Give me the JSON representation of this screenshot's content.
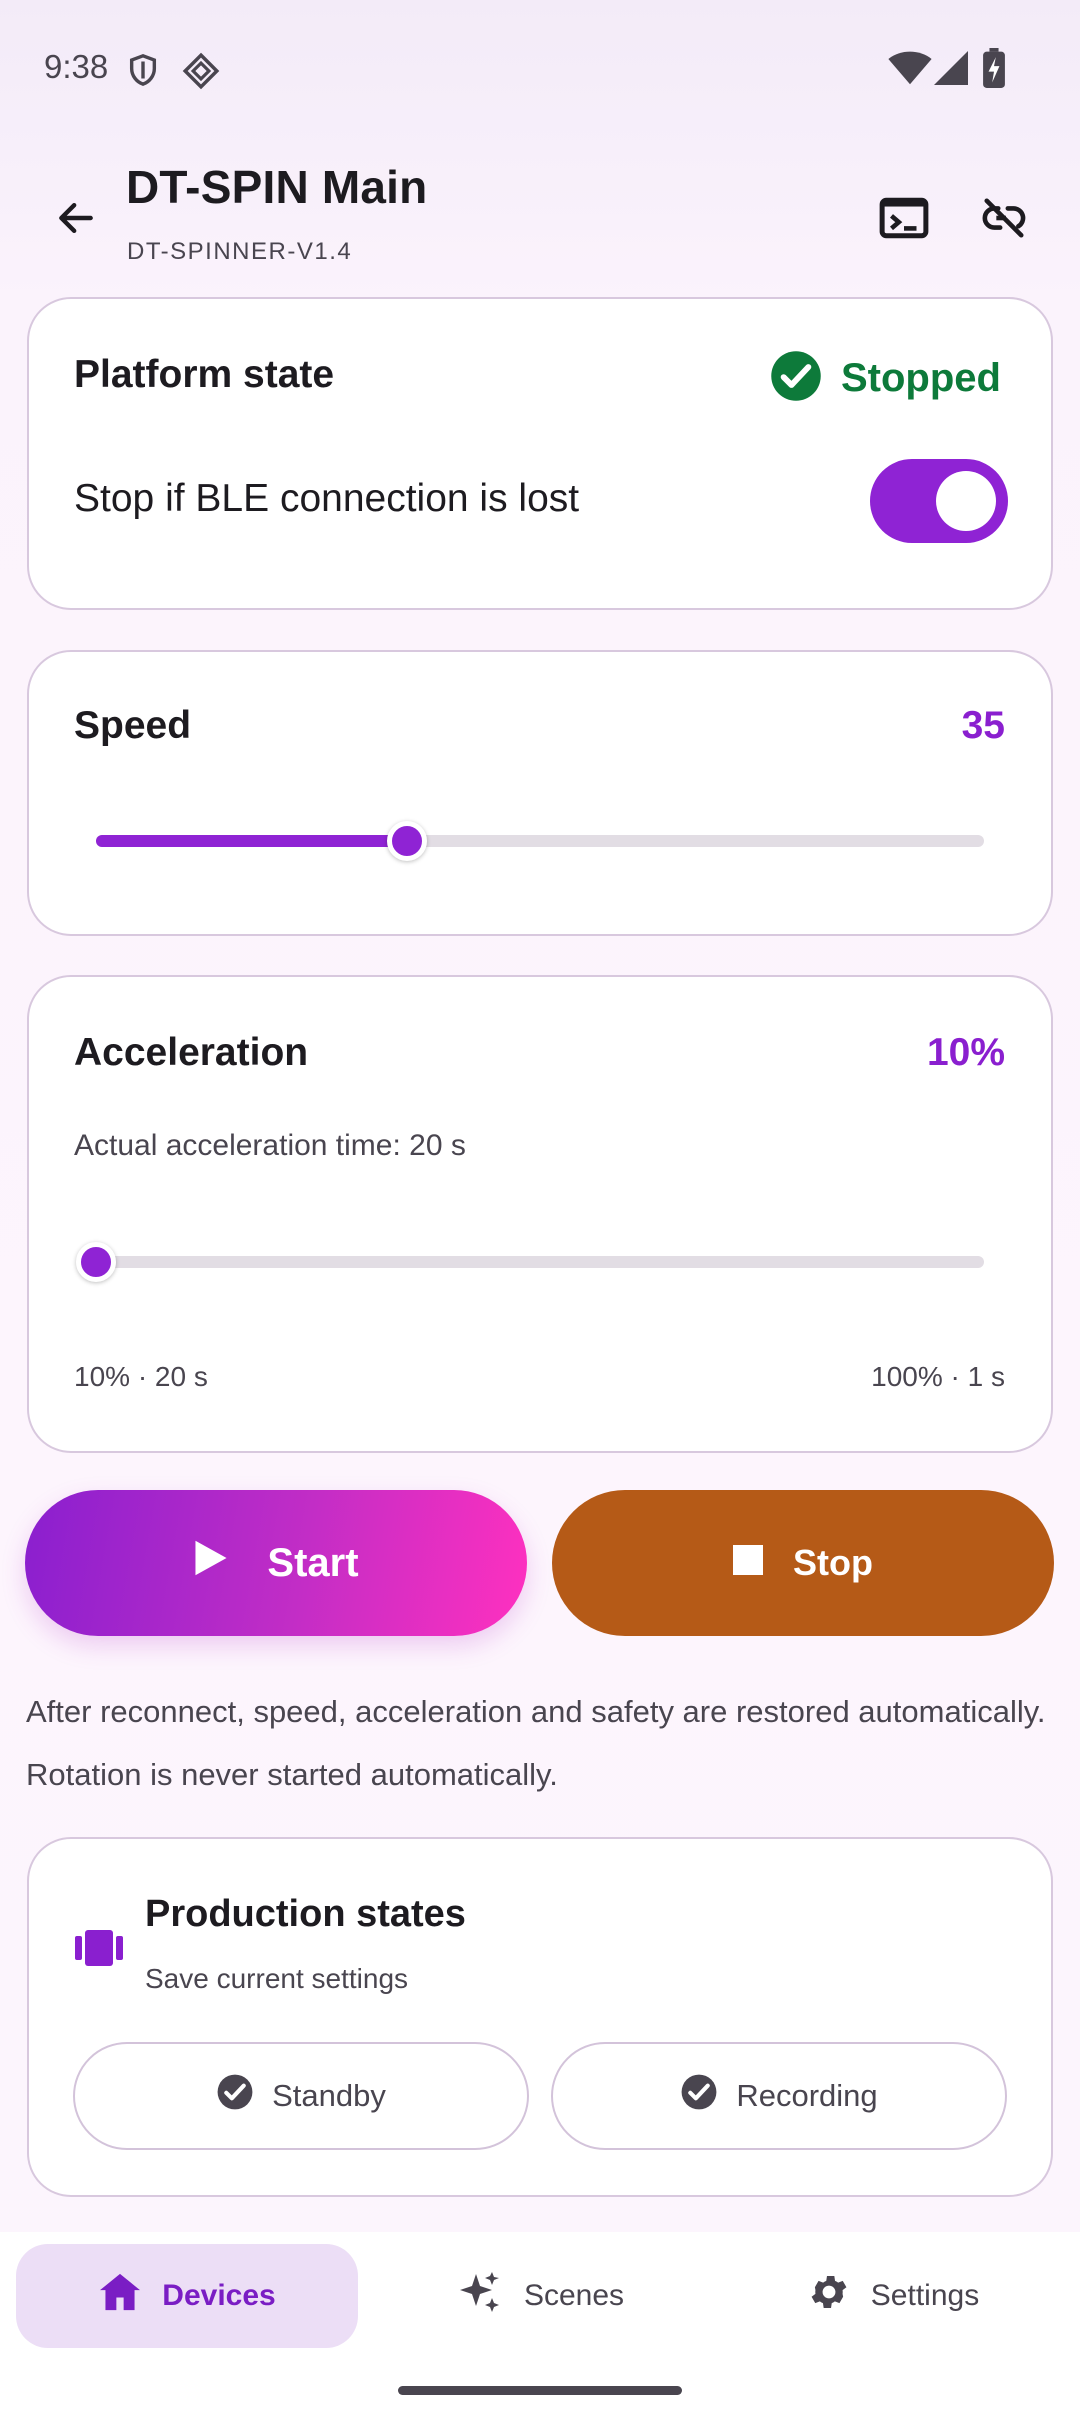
{
  "status_bar": {
    "time": "9:38",
    "icons": [
      "shield-icon",
      "diamond-icon",
      "wifi-icon",
      "cellular-icon",
      "battery-charging-icon"
    ]
  },
  "app_bar": {
    "title": "DT-SPIN Main",
    "subtitle": "DT-SPINNER-V1.4",
    "icons": [
      "back-arrow-icon",
      "terminal-icon",
      "link-off-icon"
    ]
  },
  "platform_card": {
    "title": "Platform state",
    "status": "Stopped",
    "status_color": "#0d7a3a",
    "safety_label": "Stop if BLE connection is lost",
    "safety_enabled": true
  },
  "speed_card": {
    "title": "Speed",
    "value": "35",
    "slider_fraction": 0.35
  },
  "acceleration_card": {
    "title": "Acceleration",
    "value": "10%",
    "actual_time": "Actual acceleration time: 20 s",
    "slider_fraction": 0.0,
    "min_label": "10% · 20 s",
    "max_label": "100% · 1 s"
  },
  "actions": {
    "start_label": "Start",
    "stop_label": "Stop"
  },
  "note": "After reconnect, speed, acceleration and safety are restored automatically. Rotation is never started automatically.",
  "production_card": {
    "title": "Production states",
    "subtitle": "Save current settings",
    "presets": [
      "Standby",
      "Recording"
    ]
  },
  "bottom_nav": {
    "items": [
      {
        "label": "Devices",
        "icon": "home-icon",
        "active": true
      },
      {
        "label": "Scenes",
        "icon": "sparkle-icon",
        "active": false
      },
      {
        "label": "Settings",
        "icon": "gear-icon",
        "active": false
      }
    ]
  },
  "colors": {
    "accent": "#8f23d4",
    "stop_button": "#b55a17",
    "success": "#0d7a3a"
  }
}
